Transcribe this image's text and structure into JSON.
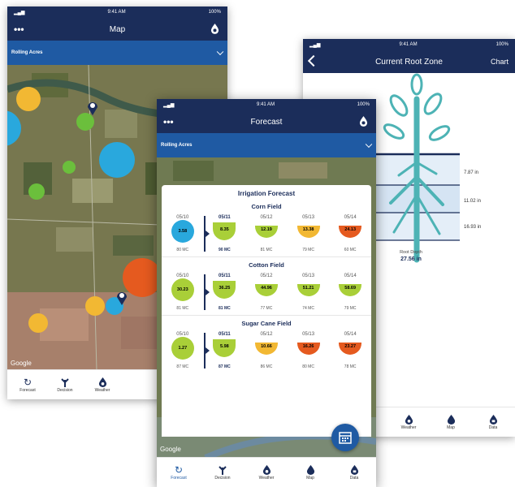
{
  "map_screen": {
    "status_time": "9:41 AM",
    "status_battery": "100%",
    "title": "Map",
    "farm": "Rolling Acres",
    "google_label": "Google",
    "tabs": [
      {
        "label": "Forecast",
        "icon": "refresh-icon"
      },
      {
        "label": "Decision",
        "icon": "sprinkler-icon"
      },
      {
        "label": "Weather",
        "icon": "weather-drop-icon"
      }
    ]
  },
  "forecast_screen": {
    "status_time": "9:41 AM",
    "status_battery": "100%",
    "title": "Forecast",
    "farm": "Rolling Acres",
    "sheet_title": "Irrigation Forecast",
    "google_label": "Google",
    "fields": [
      {
        "name": "Corn Field",
        "dates": [
          "05/10",
          "05/11",
          "05/12",
          "05/13",
          "05/14"
        ],
        "values": [
          "3.58",
          "8.35",
          "12.19",
          "13.38",
          "24.13"
        ],
        "temps": [
          "80 MC",
          "90 MC",
          "81 MC",
          "79 MC",
          "60 MC"
        ],
        "colors": [
          "#29a8dd",
          "#a9cf38",
          "#a9cf38",
          "#f2b833",
          "#e55a1f"
        ]
      },
      {
        "name": "Cotton Field",
        "dates": [
          "05/10",
          "05/11",
          "05/12",
          "05/13",
          "05/14"
        ],
        "values": [
          "30.23",
          "36.25",
          "44.96",
          "51.21",
          "58.69"
        ],
        "temps": [
          "81 MC",
          "81 MC",
          "77 MC",
          "74 MC",
          "79 MC"
        ],
        "colors": [
          "#a9cf38",
          "#a9cf38",
          "#a9cf38",
          "#a9cf38",
          "#a9cf38"
        ]
      },
      {
        "name": "Sugar Cane Field",
        "dates": [
          "05/10",
          "05/11",
          "05/12",
          "05/13",
          "05/14"
        ],
        "values": [
          "1.27",
          "5.98",
          "10.66",
          "16.26",
          "23.27"
        ],
        "temps": [
          "87 MC",
          "87 MC",
          "86 MC",
          "80 MC",
          "78 MC"
        ],
        "colors": [
          "#a9cf38",
          "#a9cf38",
          "#f2b833",
          "#e55a1f",
          "#e55a1f"
        ]
      }
    ],
    "tabs": [
      {
        "label": "Forecast",
        "icon": "refresh-icon",
        "active": true
      },
      {
        "label": "Decision",
        "icon": "sprinkler-icon"
      },
      {
        "label": "Weather",
        "icon": "weather-drop-icon"
      },
      {
        "label": "Map",
        "icon": "map-drop-icon"
      },
      {
        "label": "Data",
        "icon": "data-drop-icon"
      }
    ]
  },
  "rootzone_screen": {
    "status_time": "9:41 AM",
    "status_battery": "100%",
    "title": "Current Root Zone",
    "chart_link": "Chart",
    "depth_labels": [
      "7.87 in",
      "11.02 in",
      "16.93 in"
    ],
    "root_depth_label": "Root Depth",
    "root_depth_value": "27.56 in",
    "tabs": [
      {
        "label": "Weather",
        "icon": "weather-drop-icon"
      },
      {
        "label": "Map",
        "icon": "map-drop-icon"
      },
      {
        "label": "Data",
        "icon": "data-drop-icon"
      }
    ]
  },
  "colors": {
    "navy": "#1b2d5a",
    "blue_bar": "#1f5aa3",
    "plant_teal": "#4db3b5",
    "soil_light": "#e4eef8"
  }
}
